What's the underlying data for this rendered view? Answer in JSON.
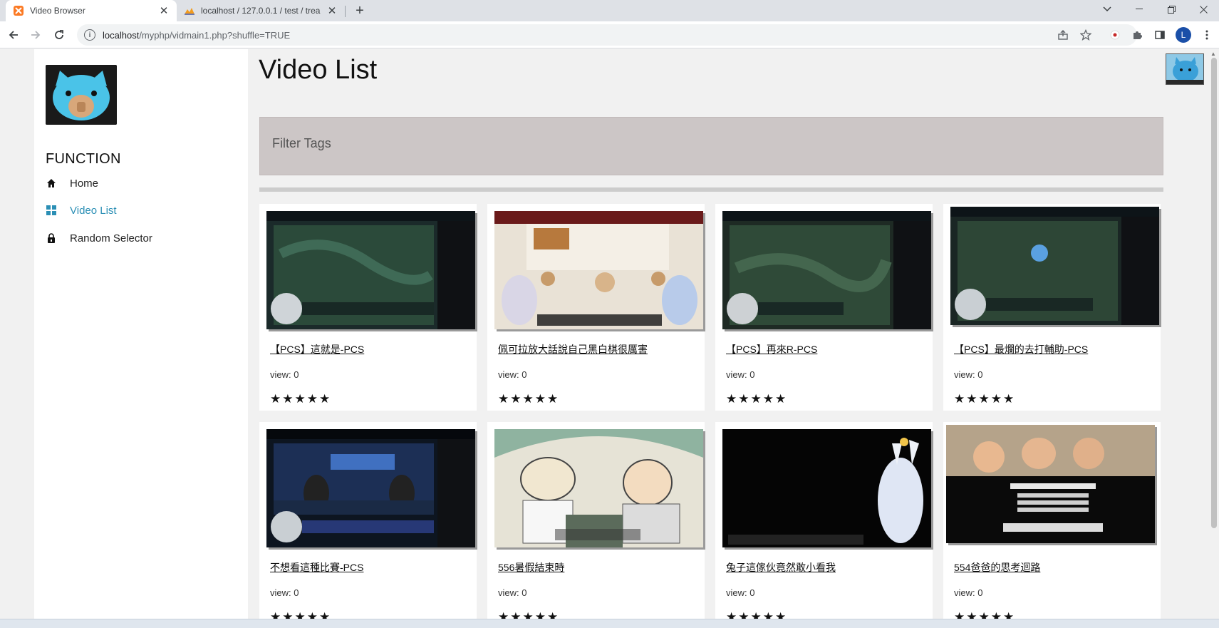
{
  "browser": {
    "tabs": [
      {
        "title": "Video Browser",
        "favicon": "xampp-icon",
        "active": true
      },
      {
        "title": "localhost / 127.0.0.1 / test / trea",
        "favicon": "phpmyadmin-icon",
        "active": false
      }
    ],
    "close_glyph": "✕",
    "new_tab_glyph": "+",
    "url_host": "localhost",
    "url_path": "/myphp/vidmain1.php?shuffle=TRUE",
    "profile_initial": "L"
  },
  "sidebar": {
    "heading": "FUNCTION",
    "items": [
      {
        "label": "Home",
        "icon": "home-icon",
        "current": false
      },
      {
        "label": "Video List",
        "icon": "grid-icon",
        "current": true
      },
      {
        "label": "Random Selector",
        "icon": "lock-icon",
        "current": false
      }
    ]
  },
  "main": {
    "title": "Video List",
    "filter_label": "Filter Tags",
    "videos": [
      {
        "title": "【PCS】這就是-PCS",
        "views": "view: 0",
        "rating": 5,
        "thumb": "lol-game-streamer"
      },
      {
        "title": "佩可拉放大話說自己黑白棋很厲害",
        "views": "view: 0",
        "rating": 5,
        "thumb": "anime-board-game"
      },
      {
        "title": "【PCS】再來R-PCS",
        "views": "view: 0",
        "rating": 5,
        "thumb": "lol-game-streamer"
      },
      {
        "title": "【PCS】最爛的去打輔助-PCS",
        "views": "view: 0",
        "rating": 5,
        "thumb": "lol-game-streamer"
      },
      {
        "title": "不想看這種比賽-PCS",
        "views": "view: 0",
        "rating": 5,
        "thumb": "esports-desk"
      },
      {
        "title": "556暑假結束時",
        "views": "view: 0",
        "rating": 5,
        "thumb": "cartoon-umbrella"
      },
      {
        "title": "兔子這傢伙竟然敢小看我",
        "views": "view: 0",
        "rating": 5,
        "thumb": "anime-bunny-dark"
      },
      {
        "title": "554爸爸的思考迴路",
        "views": "view: 0",
        "rating": 5,
        "thumb": "cartoon-credits"
      }
    ]
  },
  "colors": {
    "accent": "#2b8fb5",
    "filter_bg": "#ccc6c6",
    "tab_strip": "#dee1e6"
  }
}
